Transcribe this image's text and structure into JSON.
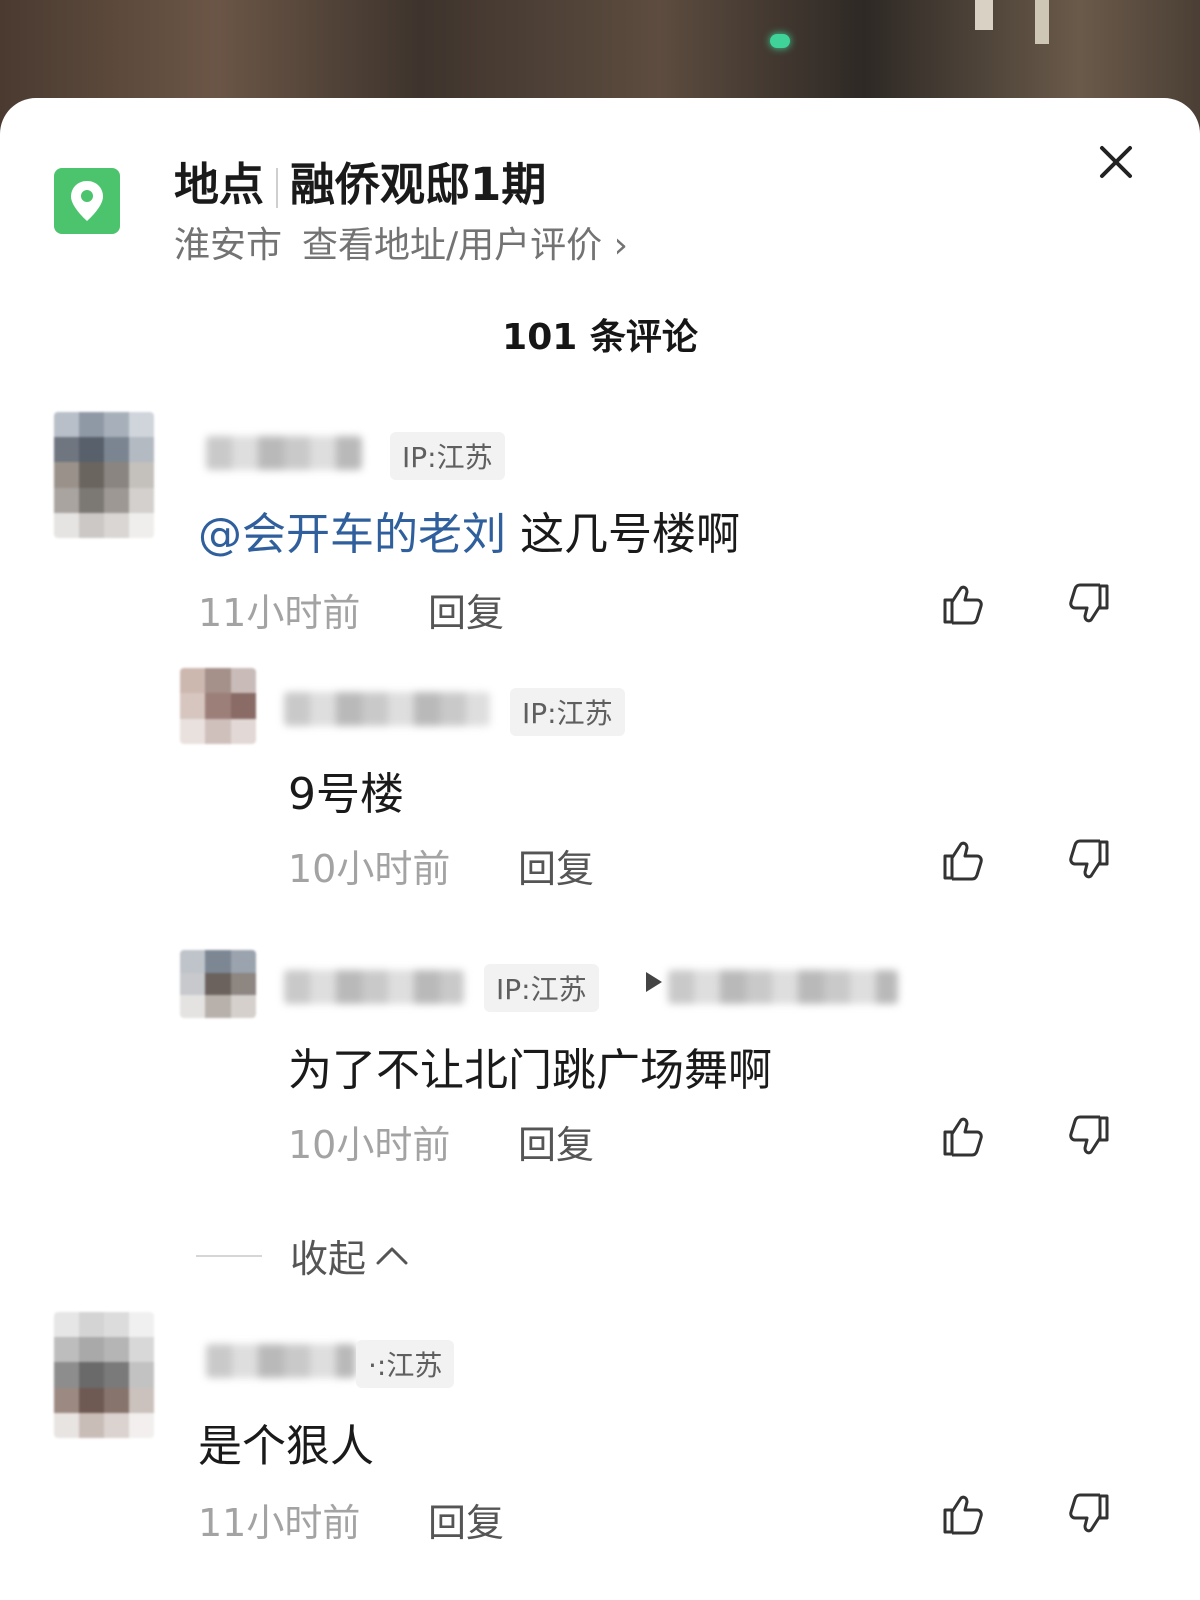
{
  "location": {
    "label": "地点",
    "name": "融侨观邸1期",
    "city": "淮安市",
    "link_text": "查看地址/用户评价 ›"
  },
  "comments_count": "101 条评论",
  "comments": [
    {
      "ip": "IP:江苏",
      "mention": "@会开车的老刘",
      "text": "这几号楼啊",
      "time": "11小时前",
      "reply_label": "回复",
      "replies": [
        {
          "ip": "IP:江苏",
          "text": "9号楼",
          "time": "10小时前",
          "reply_label": "回复"
        },
        {
          "ip": "IP:江苏",
          "text": "为了不让北门跳广场舞啊",
          "time": "10小时前",
          "reply_label": "回复"
        }
      ],
      "collapse_label": "收起"
    },
    {
      "ip": "·:江苏",
      "text": "是个狠人",
      "time": "11小时前",
      "reply_label": "回复"
    }
  ],
  "icons": {
    "location": "location-pin-icon",
    "close": "close-icon",
    "like": "thumbs-up-icon",
    "dislike": "thumbs-down-icon",
    "collapse": "chevron-up-icon",
    "reply_to": "triangle-right-icon"
  },
  "colors": {
    "location_icon_bg": "#4cc36d",
    "mention": "#2f5f9c"
  }
}
